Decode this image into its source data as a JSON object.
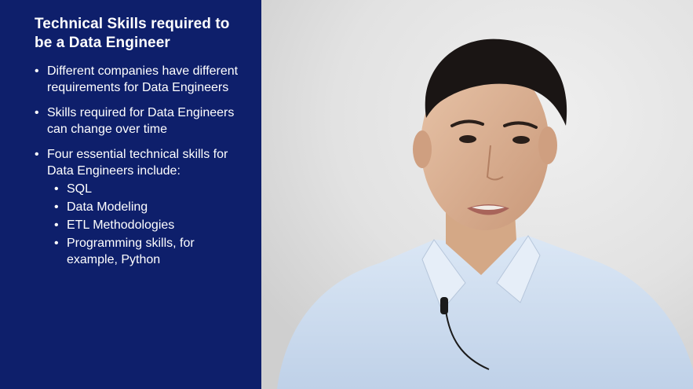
{
  "slide": {
    "title": "Technical Skills required to be a Data Engineer",
    "bullets": [
      "Different companies have different requirements for Data Engineers",
      "Skills required for Data Engineers can change over time",
      "Four essential technical skills for Data Engineers include:"
    ],
    "sub_bullets": [
      "SQL",
      "Data Modeling",
      "ETL Methodologies",
      "Programming skills, for example, Python"
    ]
  },
  "colors": {
    "slide_background": "#0e1f6b",
    "slide_text": "#ffffff",
    "wall": "#e4e4e4",
    "shirt": "#cdddf0"
  },
  "video": {
    "subject": "presenter-video"
  }
}
